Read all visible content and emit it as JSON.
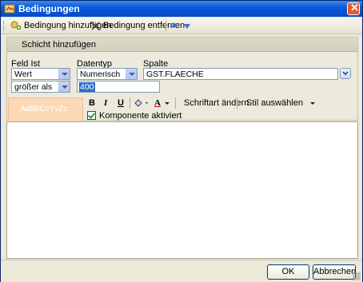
{
  "window": {
    "title": "Bedingungen"
  },
  "toolbar": {
    "add_label": "Bedingung hinzufügen",
    "remove_label": "Bedingung entfernen"
  },
  "panel": {
    "header": "Schicht hinzufügen",
    "feld_label": "Feld Ist",
    "datentyp_label": "Datentyp",
    "spalte_label": "Spalte",
    "feld_value": "Wert",
    "datentyp_value": "Numerisch",
    "spalte_value": "GST.FLAECHE",
    "operator_value": "größer als",
    "compare_value": "400"
  },
  "format": {
    "preview_text": "AaBbCcYyZz",
    "bold": "B",
    "italic": "I",
    "underline": "U",
    "font_color_letter": "A",
    "font_change": "Schriftart ändern",
    "style_select": "Stil auswählen",
    "component_active": "Komponente aktiviert"
  },
  "buttons": {
    "ok": "OK",
    "cancel": "Abbrechen"
  },
  "colors": {
    "titlebar": "#0b5bd8",
    "preview_bg": "#fcd8b6",
    "selection": "#316ac5"
  }
}
